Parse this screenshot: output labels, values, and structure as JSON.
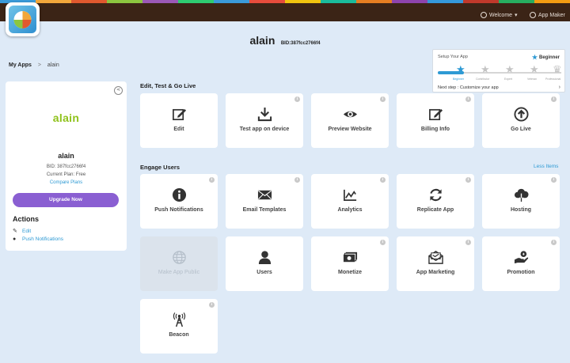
{
  "header": {
    "stripe_colors": [
      "#3a9ad9",
      "#f2a73b",
      "#e0592e",
      "#8cc63f",
      "#9b59b6",
      "#2ecc71",
      "#3a9ad9",
      "#e74c3c",
      "#f1c40f",
      "#1abc9c",
      "#e67e22",
      "#8e44ad",
      "#3498db",
      "#c0392b",
      "#27ae60",
      "#f39c12"
    ],
    "welcome_label": "Welcome",
    "appmaker_label": "App Maker"
  },
  "page": {
    "title": "alain",
    "bid": "BID:387fcc2766f4"
  },
  "breadcrumb": {
    "root": "My Apps",
    "separator": ">",
    "current": "alain"
  },
  "setup": {
    "label": "Setup Your App",
    "level": "Beginner",
    "progress": 0.21,
    "steps": [
      "Beginner",
      "Contributor",
      "Expert",
      "Veteran",
      "Professional"
    ],
    "next_step": "Next step : Customize your app"
  },
  "profile": {
    "logo_text": "alain",
    "name": "alain",
    "bid": "BID: 387fcc2766f4",
    "plan": "Current Plan: Free",
    "compare": "Compare Plans",
    "upgrade": "Upgrade Now",
    "actions_title": "Actions",
    "actions": [
      "Edit",
      "Push Notifications"
    ]
  },
  "sections": {
    "edit_test": "Edit, Test & Go Live",
    "engage": "Engage Users",
    "less_items": "Less Items"
  },
  "tiles": {
    "edit": "Edit",
    "test": "Test app on device",
    "preview": "Preview Website",
    "billing": "Billing Info",
    "golive": "Go Live",
    "push": "Push Notifications",
    "email": "Email Templates",
    "analytics": "Analytics",
    "replicate": "Replicate App",
    "hosting": "Hosting",
    "public": "Make App Public",
    "users": "Users",
    "monetize": "Monetize",
    "marketing": "App Marketing",
    "promotion": "Promotion",
    "beacon": "Beacon"
  },
  "colors": {
    "accent": "#2e9ad4",
    "upgrade": "#8a5fd2",
    "topbar": "#3b2416",
    "logo_green": "#8fc21b"
  }
}
